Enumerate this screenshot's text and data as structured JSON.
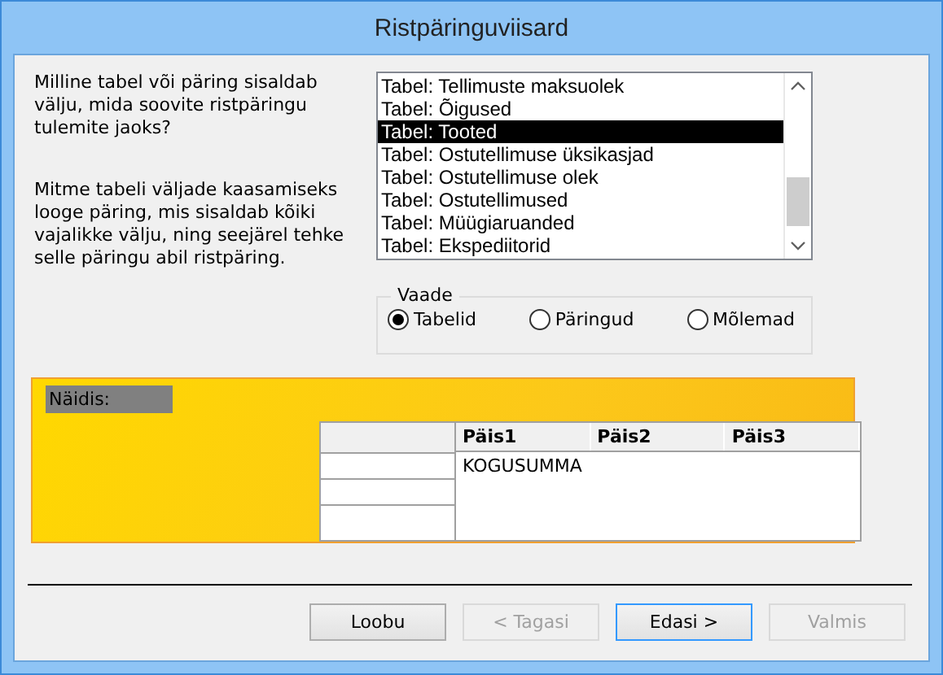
{
  "window": {
    "title": "Ristpäringuviisard"
  },
  "prompt": "Milline tabel või päring sisaldab välju, mida soovite ristpäringu tulemite jaoks?",
  "hint": "Mitme tabeli väljade kaasamiseks looge päring, mis sisaldab kõiki vajalikke välju, ning seejärel tehke selle päringu abil ristpäring.",
  "object_list": {
    "items": [
      {
        "label": "Tabel: Tellimuste maksuolek",
        "selected": false
      },
      {
        "label": "Tabel: Õigused",
        "selected": false
      },
      {
        "label": "Tabel: Tooted",
        "selected": true
      },
      {
        "label": "Tabel: Ostutellimuse üksikasjad",
        "selected": false
      },
      {
        "label": "Tabel: Ostutellimuse olek",
        "selected": false
      },
      {
        "label": "Tabel: Ostutellimused",
        "selected": false
      },
      {
        "label": "Tabel: Müügiaruanded",
        "selected": false
      },
      {
        "label": "Tabel: Ekspediitorid",
        "selected": false
      }
    ]
  },
  "view_group": {
    "label": "Vaade",
    "options": [
      {
        "label": "Tabelid",
        "selected": true
      },
      {
        "label": "Päringud",
        "selected": false
      },
      {
        "label": "Mõlemad",
        "selected": false
      }
    ]
  },
  "sample": {
    "label": "Näidis:",
    "columns": [
      "Päis1",
      "Päis2",
      "Päis3"
    ],
    "cell": "KOGUSUMMA"
  },
  "buttons": [
    {
      "label": "Loobu",
      "disabled": false,
      "focused": false
    },
    {
      "label": "< Tagasi",
      "disabled": true,
      "focused": false
    },
    {
      "label": "Edasi >",
      "disabled": false,
      "focused": true
    },
    {
      "label": "Valmis",
      "disabled": true,
      "focused": false
    }
  ]
}
